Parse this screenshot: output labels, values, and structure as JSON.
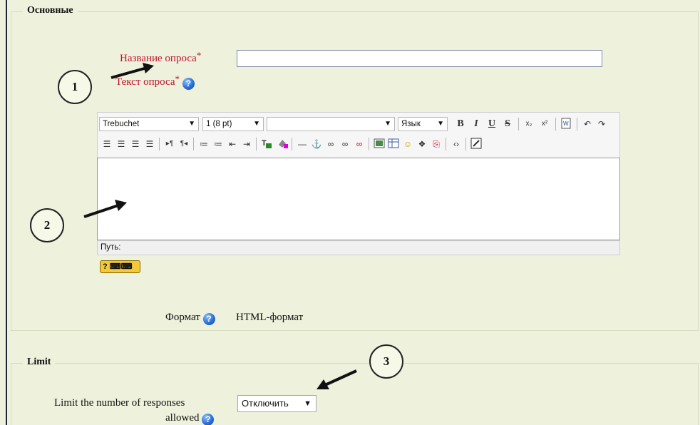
{
  "sections": {
    "general": {
      "legend": "Основные",
      "survey_name": {
        "label": "Название опроса",
        "required_mark": "*",
        "value": ""
      },
      "survey_text": {
        "label": "Текст опроса",
        "required_mark": "*"
      },
      "format": {
        "label": "Формат",
        "value": "HTML-формат"
      }
    },
    "limit": {
      "legend": "Limit",
      "limit_label_line1": "Limit the number of responses",
      "limit_label_line2": "allowed",
      "limit_value": "Отключить"
    }
  },
  "editor": {
    "font_family": "Trebuchet",
    "font_size": "1 (8 pt)",
    "style": "",
    "language": "Язык",
    "status_path": "Путь:"
  },
  "callouts": [
    "1",
    "2",
    "3"
  ],
  "icons": {
    "help": "help-question-icon",
    "keyboard": "keyboard-help-icon"
  },
  "colors": {
    "background": "#eef2dc",
    "required_label": "#c0122a",
    "help_icon": "#2a6fd6"
  }
}
